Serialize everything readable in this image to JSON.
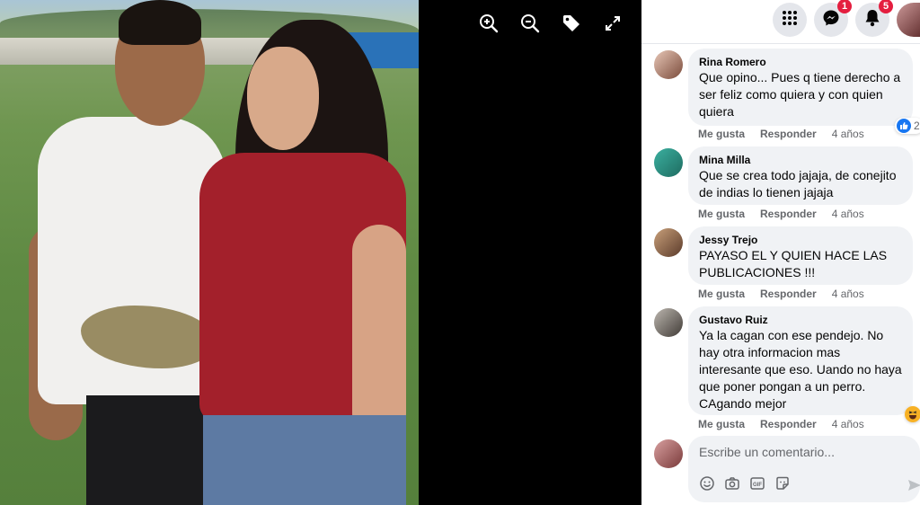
{
  "viewer": {
    "tools": [
      {
        "icon": "zoom-in-icon"
      },
      {
        "icon": "zoom-out-icon"
      },
      {
        "icon": "tag-icon"
      },
      {
        "icon": "fullscreen-icon"
      }
    ]
  },
  "topbar": {
    "menu_icon": "grid-menu-icon",
    "messenger_badge": "1",
    "notifications_badge": "5"
  },
  "comments": [
    {
      "name": "Rina Romero",
      "text": "Que opino... Pues q tiene derecho a ser feliz como quiera y con quien quiera",
      "like": "Me gusta",
      "reply": "Responder",
      "time": "4 años",
      "reaction_count": "2",
      "reaction": "like-icon"
    },
    {
      "name": "Mina Milla",
      "text": "Que se crea todo jajaja, de conejito de indias lo tienen jajaja",
      "like": "Me gusta",
      "reply": "Responder",
      "time": "4 años"
    },
    {
      "name": "Jessy Trejo",
      "text": "PAYASO EL Y QUIEN HACE LAS PUBLICACIONES !!!",
      "like": "Me gusta",
      "reply": "Responder",
      "time": "4 años"
    },
    {
      "name": "Gustavo Ruiz",
      "text": "Ya la cagan con ese pendejo. No hay otra informacion mas interesante que eso. Uando no haya que poner pongan a un perro. CAgando mejor",
      "like": "Me gusta",
      "reply": "Responder",
      "time": "4 años",
      "reaction": "haha-icon"
    }
  ],
  "composer": {
    "placeholder": "Escribe un comentario..."
  }
}
